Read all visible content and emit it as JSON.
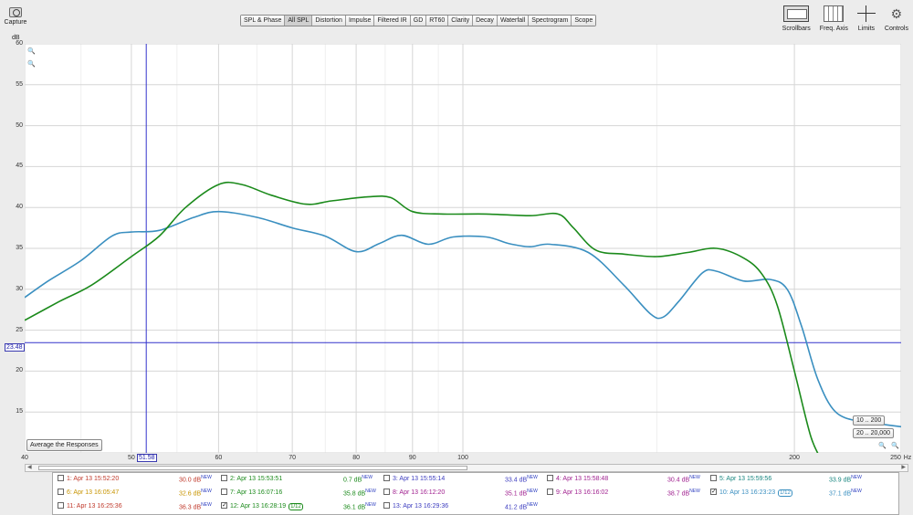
{
  "toolbar": {
    "capture_label": "Capture",
    "tabs": [
      "SPL & Phase",
      "All SPL",
      "Distortion",
      "Impulse",
      "Filtered IR",
      "GD",
      "RT60",
      "Clarity",
      "Decay",
      "Waterfall",
      "Spectrogram",
      "Scope"
    ],
    "active_tab": "All SPL",
    "tools": [
      {
        "label": "Scrollbars",
        "icon": "scrollbars-icon"
      },
      {
        "label": "Freq. Axis",
        "icon": "freq-axis-icon"
      },
      {
        "label": "Limits",
        "icon": "limits-icon"
      },
      {
        "label": "Controls",
        "icon": "gear-icon"
      }
    ]
  },
  "graph": {
    "y_unit": "dB",
    "x_unit": "Hz",
    "cursor_x_value": "51.58",
    "cursor_y_value": "23.48",
    "average_button": "Average the Responses",
    "range_buttons": [
      {
        "lo": "10",
        "hi": "200"
      },
      {
        "lo": "20",
        "hi": "20,000"
      }
    ]
  },
  "chart_data": {
    "type": "line",
    "x_scale": "log",
    "xlim": [
      40,
      250
    ],
    "ylim": [
      10,
      60
    ],
    "x_ticks": [
      40,
      50,
      60,
      70,
      80,
      90,
      100,
      200,
      250
    ],
    "y_ticks": [
      15,
      20,
      25,
      30,
      35,
      40,
      45,
      50,
      55,
      60
    ],
    "grid": true,
    "cursor": {
      "x": 51.58,
      "y": 23.48
    },
    "series": [
      {
        "name": "10: Apr 13 16:23:23",
        "color": "#3a8fc0",
        "points": [
          [
            40,
            29
          ],
          [
            42,
            31
          ],
          [
            45,
            33.5
          ],
          [
            48,
            36.5
          ],
          [
            50,
            37
          ],
          [
            53,
            37.2
          ],
          [
            57,
            38.8
          ],
          [
            60,
            39.5
          ],
          [
            65,
            38.8
          ],
          [
            70,
            37.5
          ],
          [
            75,
            36.5
          ],
          [
            80,
            34.6
          ],
          [
            84,
            35.6
          ],
          [
            88,
            36.6
          ],
          [
            93,
            35.5
          ],
          [
            98,
            36.4
          ],
          [
            105,
            36.4
          ],
          [
            110,
            35.6
          ],
          [
            115,
            35.2
          ],
          [
            120,
            35.5
          ],
          [
            130,
            34.5
          ],
          [
            140,
            30.5
          ],
          [
            148,
            27
          ],
          [
            152,
            26.6
          ],
          [
            157,
            28.5
          ],
          [
            165,
            32
          ],
          [
            170,
            32.2
          ],
          [
            180,
            31
          ],
          [
            190,
            31.2
          ],
          [
            197,
            30
          ],
          [
            203,
            25.5
          ],
          [
            210,
            19
          ],
          [
            218,
            15
          ],
          [
            230,
            13.8
          ],
          [
            240,
            13.5
          ],
          [
            250,
            13.2
          ]
        ]
      },
      {
        "name": "12: Apr 13 16:28:19",
        "color": "#1b8a1b",
        "points": [
          [
            40,
            26.2
          ],
          [
            43,
            28.5
          ],
          [
            46,
            30.5
          ],
          [
            50,
            34
          ],
          [
            53,
            36.5
          ],
          [
            56,
            40
          ],
          [
            60,
            42.8
          ],
          [
            63,
            42.8
          ],
          [
            67,
            41.5
          ],
          [
            72,
            40.4
          ],
          [
            76,
            40.8
          ],
          [
            82,
            41.3
          ],
          [
            86,
            41.2
          ],
          [
            90,
            39.5
          ],
          [
            96,
            39.2
          ],
          [
            105,
            39.2
          ],
          [
            115,
            39
          ],
          [
            122,
            39.2
          ],
          [
            126,
            37.5
          ],
          [
            132,
            34.8
          ],
          [
            140,
            34.3
          ],
          [
            150,
            34
          ],
          [
            160,
            34.5
          ],
          [
            170,
            35
          ],
          [
            180,
            33.8
          ],
          [
            187,
            31.8
          ],
          [
            193,
            28
          ],
          [
            200,
            20
          ],
          [
            207,
            12
          ],
          [
            212,
            9
          ]
        ]
      }
    ]
  },
  "legend": {
    "rows": [
      [
        {
          "label": "1: Apr 13 15:52:20",
          "value": "30.0 dB",
          "checked": false,
          "color": "#c0392b"
        },
        {
          "label": "2: Apr 13 15:53:51",
          "value": "0.7 dB",
          "checked": false,
          "color": "#1b8a1b"
        },
        {
          "label": "3: Apr 13 15:55:14",
          "value": "33.4 dB",
          "checked": false,
          "color": "#3b3bbf"
        },
        {
          "label": "4: Apr 13 15:58:48",
          "value": "30.4 dB",
          "checked": false,
          "color": "#a0208f"
        },
        {
          "label": "5: Apr 13 15:59:56",
          "value": "33.9 dB",
          "checked": false,
          "color": "#17857f"
        }
      ],
      [
        {
          "label": "6: Apr 13 16:05:47",
          "value": "32.6 dB",
          "checked": false,
          "color": "#c79400"
        },
        {
          "label": "7: Apr 13 16:07:16",
          "value": "35.8 dB",
          "checked": false,
          "color": "#1b8a1b"
        },
        {
          "label": "8: Apr 13 16:12:20",
          "value": "35.1 dB",
          "checked": false,
          "color": "#a0208f"
        },
        {
          "label": "9: Apr 13 16:16:02",
          "value": "38.7 dB",
          "checked": false,
          "color": "#a0208f"
        },
        {
          "label": "10: Apr 13 16:23:23",
          "value": "37.1 dB",
          "checked": true,
          "color": "#3a8fc0",
          "smoothing": "1/12"
        }
      ],
      [
        {
          "label": "11: Apr 13 16:25:36",
          "value": "36.3 dB",
          "checked": false,
          "color": "#c0392b"
        },
        {
          "label": "12: Apr 13 16:28:19",
          "value": "36.1 dB",
          "checked": true,
          "color": "#1b8a1b",
          "smoothing": "1/12"
        },
        {
          "label": "13: Apr 13 16:29:36",
          "value": "41.2 dB",
          "checked": false,
          "color": "#3b3bbf"
        }
      ]
    ],
    "new_tag": "NEW"
  }
}
